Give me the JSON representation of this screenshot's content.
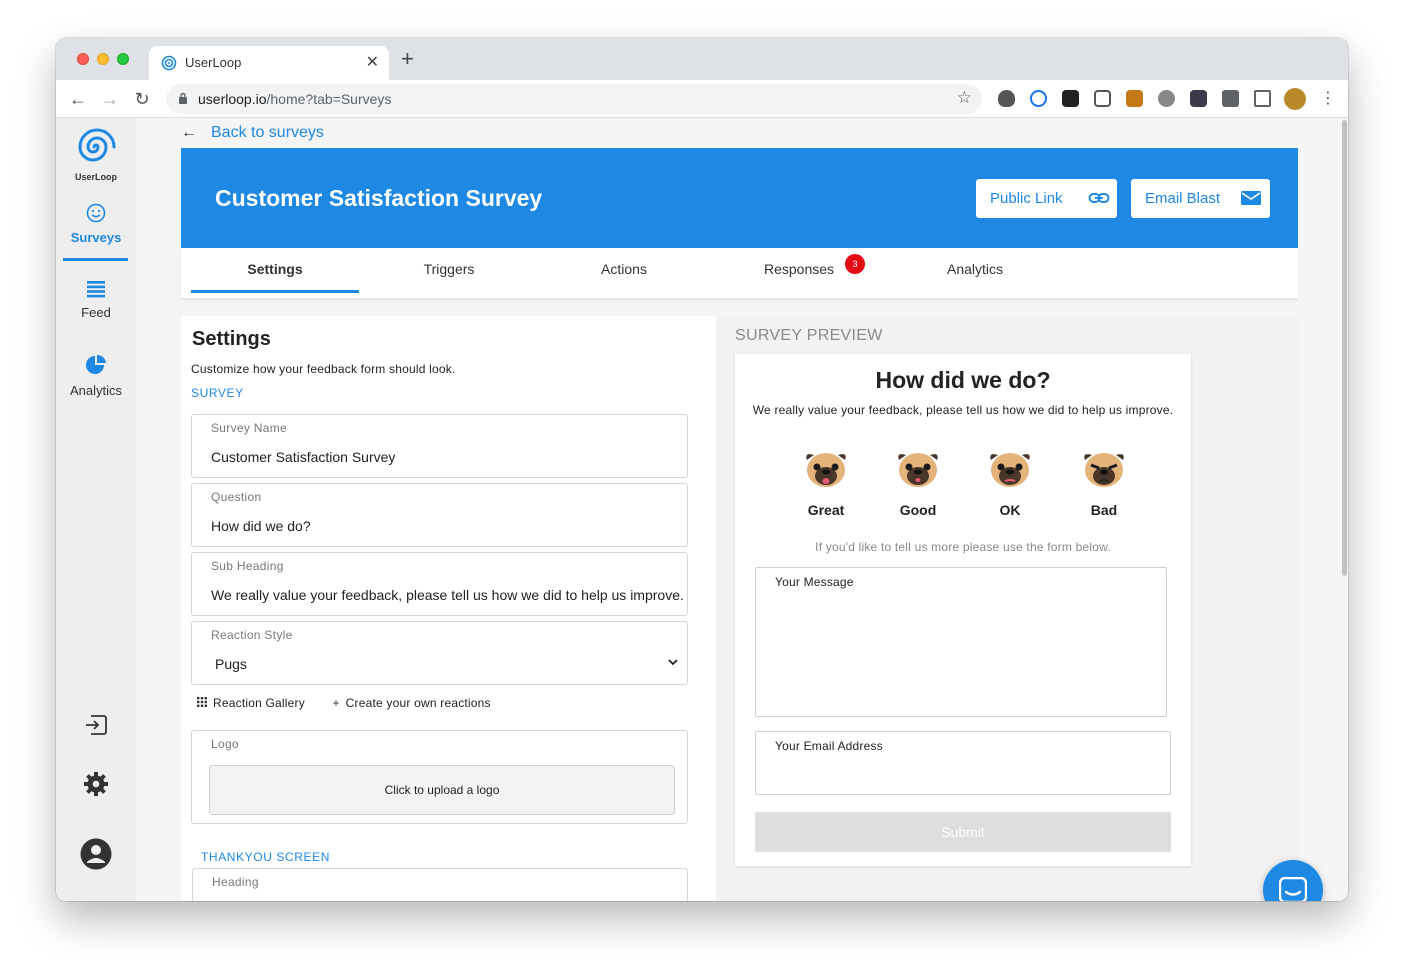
{
  "browser": {
    "tab_title": "UserLoop",
    "url_host": "userloop.io",
    "url_path": "/home?tab=Surveys"
  },
  "sidebar": {
    "logo_text": "UserLoop",
    "items": [
      {
        "label": "Surveys",
        "icon": "smiley-icon"
      },
      {
        "label": "Feed",
        "icon": "feed-list-icon"
      },
      {
        "label": "Analytics",
        "icon": "pie-chart-icon"
      }
    ],
    "bottom_icons": [
      "logout-icon",
      "gear-icon",
      "account-icon"
    ]
  },
  "header": {
    "back_label": "Back to surveys",
    "title": "Customer Satisfaction Survey",
    "public_link_label": "Public Link",
    "email_blast_label": "Email Blast"
  },
  "tabs": [
    {
      "label": "Settings",
      "active": true
    },
    {
      "label": "Triggers"
    },
    {
      "label": "Actions"
    },
    {
      "label": "Responses",
      "badge": "3"
    },
    {
      "label": "Analytics"
    }
  ],
  "settings": {
    "title": "Settings",
    "description": "Customize how your feedback form should look.",
    "survey_section": "SURVEY",
    "fields": [
      {
        "label": "Survey Name",
        "value": "Customer Satisfaction Survey"
      },
      {
        "label": "Question",
        "value": "How did we do?"
      },
      {
        "label": "Sub Heading",
        "value": "We really value your feedback, please tell us how we did to help us improve."
      },
      {
        "label": "Reaction Style",
        "value": "Pugs"
      }
    ],
    "reaction_gallery_label": "Reaction Gallery",
    "create_reactions_label": "Create your own reactions",
    "logo_label": "Logo",
    "upload_label": "Click to upload a logo",
    "thankyou_section": "THANKYOU SCREEN",
    "heading_label": "Heading"
  },
  "preview": {
    "section_label": "SURVEY PREVIEW",
    "question": "How did we do?",
    "sub_heading": "We really value your feedback, please tell us how we did to help us improve.",
    "reactions": [
      "Great",
      "Good",
      "OK",
      "Bad"
    ],
    "more_text": "If you'd like to tell us more please use the form below.",
    "message_label": "Your Message",
    "email_label": "Your Email Address",
    "submit_label": "Submit"
  },
  "colors": {
    "accent": "#1e88e5",
    "badge": "#e50914"
  }
}
